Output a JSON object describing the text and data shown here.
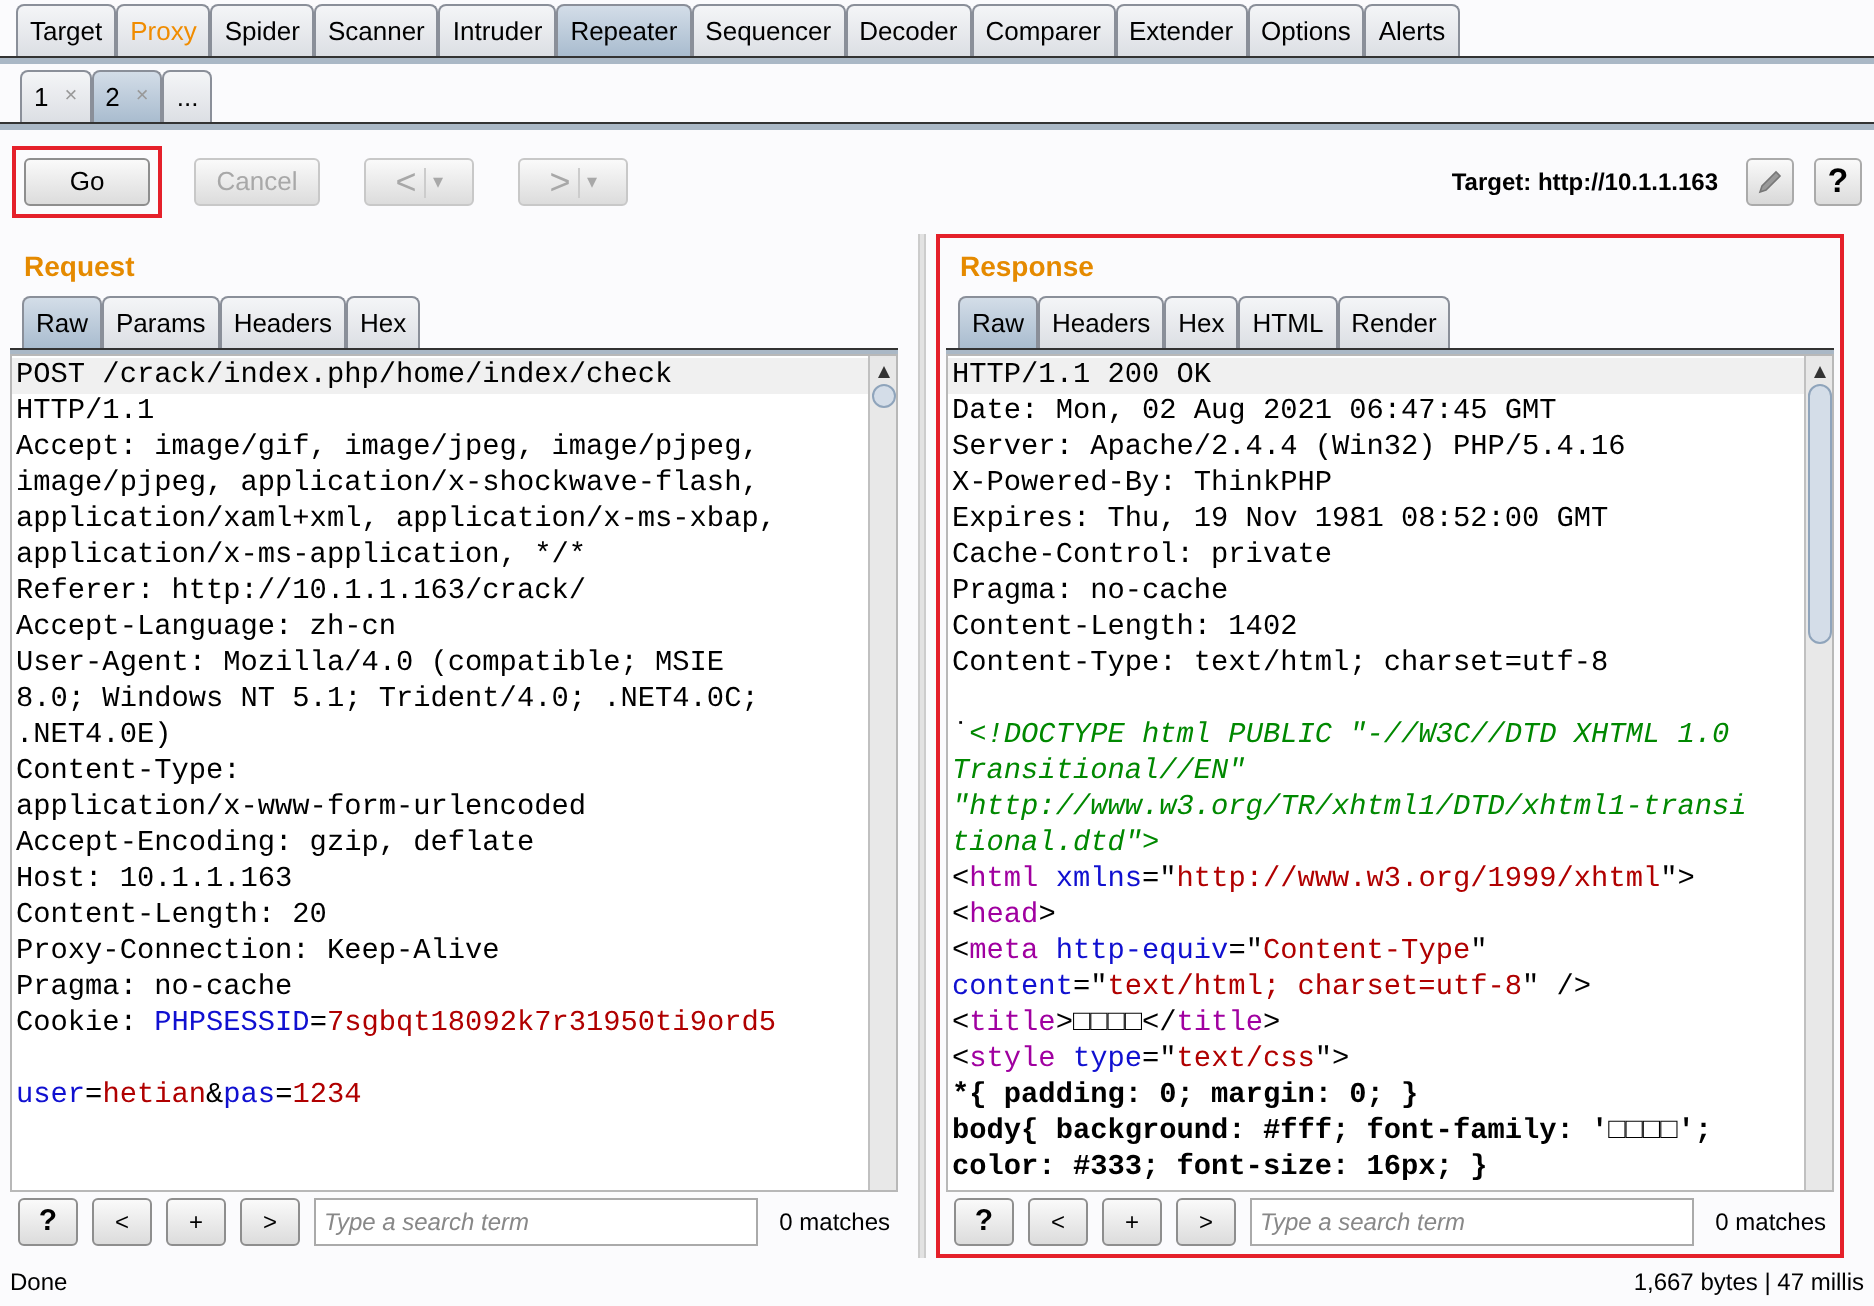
{
  "main_tabs": [
    {
      "label": "Target",
      "selected": false,
      "alert": false
    },
    {
      "label": "Proxy",
      "selected": false,
      "alert": true
    },
    {
      "label": "Spider",
      "selected": false,
      "alert": false
    },
    {
      "label": "Scanner",
      "selected": false,
      "alert": false
    },
    {
      "label": "Intruder",
      "selected": false,
      "alert": false
    },
    {
      "label": "Repeater",
      "selected": true,
      "alert": false
    },
    {
      "label": "Sequencer",
      "selected": false,
      "alert": false
    },
    {
      "label": "Decoder",
      "selected": false,
      "alert": false
    },
    {
      "label": "Comparer",
      "selected": false,
      "alert": false
    },
    {
      "label": "Extender",
      "selected": false,
      "alert": false
    },
    {
      "label": "Options",
      "selected": false,
      "alert": false
    },
    {
      "label": "Alerts",
      "selected": false,
      "alert": false
    }
  ],
  "repeater_tabs": [
    {
      "label": "1",
      "close": "×",
      "selected": false
    },
    {
      "label": "2",
      "close": "×",
      "selected": true
    },
    {
      "label": "...",
      "selected": false
    }
  ],
  "toolbar": {
    "buttons": [
      {
        "kind": "text",
        "label": "Go",
        "disabled": false,
        "highlighted": true
      },
      {
        "kind": "text",
        "label": "Cancel",
        "disabled": true
      },
      {
        "kind": "nav",
        "label": "<",
        "caret": "▾",
        "disabled": true
      },
      {
        "kind": "nav",
        "label": ">",
        "caret": "▾",
        "disabled": true
      }
    ],
    "target": "Target: http://10.1.1.163",
    "help": "?"
  },
  "panels": [
    {
      "title": "Request",
      "highlighted": false,
      "tabs": [
        {
          "label": "Raw",
          "selected": true
        },
        {
          "label": "Params",
          "selected": false
        },
        {
          "label": "Headers",
          "selected": false
        },
        {
          "label": "Hex",
          "selected": false
        }
      ],
      "lines": [
        {
          "kind": "text",
          "segments": [
            {
              "kind": "plain",
              "text": "POST /crack/index.php/home/index/check"
            }
          ]
        },
        {
          "kind": "text",
          "segments": [
            {
              "kind": "plain",
              "text": "HTTP/1.1"
            }
          ]
        },
        {
          "kind": "text",
          "segments": [
            {
              "kind": "plain",
              "text": "Accept: image/gif, image/jpeg, image/pjpeg,"
            }
          ]
        },
        {
          "kind": "text",
          "segments": [
            {
              "kind": "plain",
              "text": "image/pjpeg, application/x-shockwave-flash,"
            }
          ]
        },
        {
          "kind": "text",
          "segments": [
            {
              "kind": "plain",
              "text": "application/xaml+xml, application/x-ms-xbap,"
            }
          ]
        },
        {
          "kind": "text",
          "segments": [
            {
              "kind": "plain",
              "text": "application/x-ms-application, */*"
            }
          ]
        },
        {
          "kind": "text",
          "segments": [
            {
              "kind": "plain",
              "text": "Referer: http://10.1.1.163/crack/"
            }
          ]
        },
        {
          "kind": "text",
          "segments": [
            {
              "kind": "plain",
              "text": "Accept-Language: zh-cn"
            }
          ]
        },
        {
          "kind": "text",
          "segments": [
            {
              "kind": "plain",
              "text": "User-Agent: Mozilla/4.0 (compatible; MSIE"
            }
          ]
        },
        {
          "kind": "text",
          "segments": [
            {
              "kind": "plain",
              "text": "8.0; Windows NT 5.1; Trident/4.0; .NET4.0C;"
            }
          ]
        },
        {
          "kind": "text",
          "segments": [
            {
              "kind": "plain",
              "text": ".NET4.0E)"
            }
          ]
        },
        {
          "kind": "text",
          "segments": [
            {
              "kind": "plain",
              "text": "Content-Type:"
            }
          ]
        },
        {
          "kind": "text",
          "segments": [
            {
              "kind": "plain",
              "text": "application/x-www-form-urlencoded"
            }
          ]
        },
        {
          "kind": "text",
          "segments": [
            {
              "kind": "plain",
              "text": "Accept-Encoding: gzip, deflate"
            }
          ]
        },
        {
          "kind": "text",
          "segments": [
            {
              "kind": "plain",
              "text": "Host: 10.1.1.163"
            }
          ]
        },
        {
          "kind": "text",
          "segments": [
            {
              "kind": "plain",
              "text": "Content-Length: 20"
            }
          ]
        },
        {
          "kind": "text",
          "segments": [
            {
              "kind": "plain",
              "text": "Proxy-Connection: Keep-Alive"
            }
          ]
        },
        {
          "kind": "text",
          "segments": [
            {
              "kind": "plain",
              "text": "Pragma: no-cache"
            }
          ]
        },
        {
          "kind": "text",
          "segments": [
            {
              "kind": "plain",
              "text": "Cookie: "
            },
            {
              "kind": "name",
              "text": "PHPSESSID"
            },
            {
              "kind": "plain",
              "text": "="
            },
            {
              "kind": "value",
              "text": "7sgbqt18092k7r31950ti9ord5"
            }
          ]
        },
        {
          "kind": "blank"
        },
        {
          "kind": "text",
          "segments": [
            {
              "kind": "name",
              "text": "user"
            },
            {
              "kind": "plain",
              "text": "="
            },
            {
              "kind": "value",
              "text": "hetian"
            },
            {
              "kind": "plain",
              "text": "&"
            },
            {
              "kind": "name",
              "text": "pas"
            },
            {
              "kind": "plain",
              "text": "="
            },
            {
              "kind": "value",
              "text": "1234"
            }
          ]
        }
      ],
      "search": {
        "help": "?",
        "prev": "<",
        "add": "+",
        "next": ">",
        "placeholder": "Type a search term",
        "matches": "0 matches"
      }
    },
    {
      "title": "Response",
      "highlighted": true,
      "tabs": [
        {
          "label": "Raw",
          "selected": true
        },
        {
          "label": "Headers",
          "selected": false
        },
        {
          "label": "Hex",
          "selected": false
        },
        {
          "label": "HTML",
          "selected": false
        },
        {
          "label": "Render",
          "selected": false
        }
      ],
      "lines": [
        {
          "kind": "text",
          "segments": [
            {
              "kind": "plain",
              "text": "HTTP/1.1 200 OK"
            }
          ]
        },
        {
          "kind": "text",
          "segments": [
            {
              "kind": "plain",
              "text": "Date: Mon, 02 Aug 2021 06:47:45 GMT"
            }
          ]
        },
        {
          "kind": "text",
          "segments": [
            {
              "kind": "plain",
              "text": "Server: Apache/2.4.4 (Win32) PHP/5.4.16"
            }
          ]
        },
        {
          "kind": "text",
          "segments": [
            {
              "kind": "plain",
              "text": "X-Powered-By: ThinkPHP"
            }
          ]
        },
        {
          "kind": "text",
          "segments": [
            {
              "kind": "plain",
              "text": "Expires: Thu, 19 Nov 1981 08:52:00 GMT"
            }
          ]
        },
        {
          "kind": "text",
          "segments": [
            {
              "kind": "plain",
              "text": "Cache-Control: private"
            }
          ]
        },
        {
          "kind": "text",
          "segments": [
            {
              "kind": "plain",
              "text": "Pragma: no-cache"
            }
          ]
        },
        {
          "kind": "text",
          "segments": [
            {
              "kind": "plain",
              "text": "Content-Length: 1402"
            }
          ]
        },
        {
          "kind": "text",
          "segments": [
            {
              "kind": "plain",
              "text": "Content-Type: text/html; charset=utf-8"
            }
          ]
        },
        {
          "kind": "blank"
        },
        {
          "kind": "text",
          "segments": [
            {
              "kind": "plain",
              "text": "˙"
            },
            {
              "kind": "comment",
              "text": "<!DOCTYPE html PUBLIC \"-//W3C//DTD XHTML 1.0"
            }
          ]
        },
        {
          "kind": "text",
          "segments": [
            {
              "kind": "comment",
              "text": "Transitional//EN\""
            }
          ]
        },
        {
          "kind": "text",
          "segments": [
            {
              "kind": "comment",
              "text": "\"http://www.w3.org/TR/xhtml1/DTD/xhtml1-transi"
            }
          ]
        },
        {
          "kind": "text",
          "segments": [
            {
              "kind": "comment",
              "text": "tional.dtd\">"
            }
          ]
        },
        {
          "kind": "text",
          "segments": [
            {
              "kind": "plain",
              "text": "<"
            },
            {
              "kind": "tag",
              "text": "html"
            },
            {
              "kind": "name",
              "text": " xmlns"
            },
            {
              "kind": "plain",
              "text": "=\""
            },
            {
              "kind": "value",
              "text": "http://www.w3.org/1999/xhtml"
            },
            {
              "kind": "plain",
              "text": "\">"
            }
          ]
        },
        {
          "kind": "text",
          "segments": [
            {
              "kind": "plain",
              "text": "<"
            },
            {
              "kind": "tag",
              "text": "head"
            },
            {
              "kind": "plain",
              "text": ">"
            }
          ]
        },
        {
          "kind": "text",
          "segments": [
            {
              "kind": "plain",
              "text": "<"
            },
            {
              "kind": "tag",
              "text": "meta"
            },
            {
              "kind": "name",
              "text": " http-equiv"
            },
            {
              "kind": "plain",
              "text": "=\""
            },
            {
              "kind": "value",
              "text": "Content-Type"
            },
            {
              "kind": "plain",
              "text": "\""
            }
          ]
        },
        {
          "kind": "text",
          "segments": [
            {
              "kind": "name",
              "text": "content"
            },
            {
              "kind": "plain",
              "text": "=\""
            },
            {
              "kind": "value",
              "text": "text/html; charset=utf-8"
            },
            {
              "kind": "plain",
              "text": "\" />"
            }
          ]
        },
        {
          "kind": "text",
          "segments": [
            {
              "kind": "plain",
              "text": "<"
            },
            {
              "kind": "tag",
              "text": "title"
            },
            {
              "kind": "plain",
              "text": ">□□□□</"
            },
            {
              "kind": "tag",
              "text": "title"
            },
            {
              "kind": "plain",
              "text": ">"
            }
          ]
        },
        {
          "kind": "text",
          "segments": [
            {
              "kind": "plain",
              "text": "<"
            },
            {
              "kind": "tag",
              "text": "style"
            },
            {
              "kind": "name",
              "text": " type"
            },
            {
              "kind": "plain",
              "text": "=\""
            },
            {
              "kind": "value",
              "text": "text/css"
            },
            {
              "kind": "plain",
              "text": "\">"
            }
          ]
        },
        {
          "kind": "text",
          "segments": [
            {
              "kind": "bold",
              "text": "*{ padding: 0; margin: 0; }"
            }
          ]
        },
        {
          "kind": "text",
          "segments": [
            {
              "kind": "bold",
              "text": "body{ background: #fff; font-family: '□□□□';"
            }
          ]
        },
        {
          "kind": "text",
          "segments": [
            {
              "kind": "bold",
              "text": "color: #333; font-size: 16px; }"
            }
          ]
        }
      ],
      "search": {
        "help": "?",
        "prev": "<",
        "add": "+",
        "next": ">",
        "placeholder": "Type a search term",
        "matches": "0 matches"
      }
    }
  ],
  "status_bar": {
    "left": "Done",
    "right": "1,667 bytes | 47 millis"
  }
}
